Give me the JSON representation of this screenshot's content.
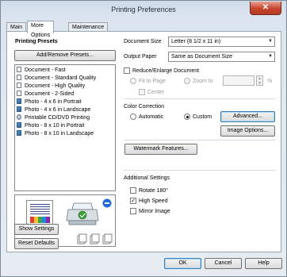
{
  "window": {
    "title": "Printing Preferences",
    "close_glyph": "✕"
  },
  "tabs": [
    {
      "label": "Main"
    },
    {
      "label": "More Options"
    },
    {
      "label": "Maintenance"
    }
  ],
  "presets": {
    "heading": "Printing Presets",
    "add_remove_label": "Add/Remove Presets...",
    "items": [
      {
        "label": "Document - Fast",
        "icon": "document-icon"
      },
      {
        "label": "Document - Standard Quality",
        "icon": "document-icon"
      },
      {
        "label": "Document - High Quality",
        "icon": "document-icon"
      },
      {
        "label": "Document - 2-Sided",
        "icon": "document-icon"
      },
      {
        "label": "Photo - 4 x 6 in Portrait",
        "icon": "photo-icon"
      },
      {
        "label": "Photo - 4 x 6 in Landscape",
        "icon": "photo-icon"
      },
      {
        "label": "Printable CD/DVD Printing",
        "icon": "disc-icon"
      },
      {
        "label": "Photo - 8 x 10 in Portrait",
        "icon": "photo-icon"
      },
      {
        "label": "Photo - 8 x 10 in Landscape",
        "icon": "photo-icon"
      }
    ]
  },
  "document_size": {
    "label": "Document Size",
    "value": "Letter (8 1/2 x 11 in)"
  },
  "output_paper": {
    "label": "Output Paper",
    "value": "Same as Document Size"
  },
  "reduce_enlarge": {
    "label": "Reduce/Enlarge Document",
    "checked": false,
    "fit_to_page": "Fit to Page",
    "zoom_to": "Zoom to",
    "percent": "%",
    "center": "Center"
  },
  "color_correction": {
    "heading": "Color Correction",
    "automatic": "Automatic",
    "custom": "Custom",
    "selected": "Custom",
    "advanced_label": "Advanced...",
    "image_options_label": "Image Options..."
  },
  "watermark_label": "Watermark Features...",
  "additional_settings": {
    "heading": "Additional Settings",
    "rotate": {
      "label": "Rotate 180°",
      "checked": false
    },
    "high_speed": {
      "label": "High Speed",
      "checked": true
    },
    "mirror": {
      "label": "Mirror Image",
      "checked": false
    }
  },
  "show_settings_label": "Show Settings",
  "reset_defaults_label": "Reset Defaults",
  "footer": {
    "ok": "OK",
    "cancel": "Cancel",
    "help": "Help"
  },
  "check_mark": "✓",
  "colors": {
    "accent": "#3c7fb1",
    "close": "#c7432c"
  }
}
